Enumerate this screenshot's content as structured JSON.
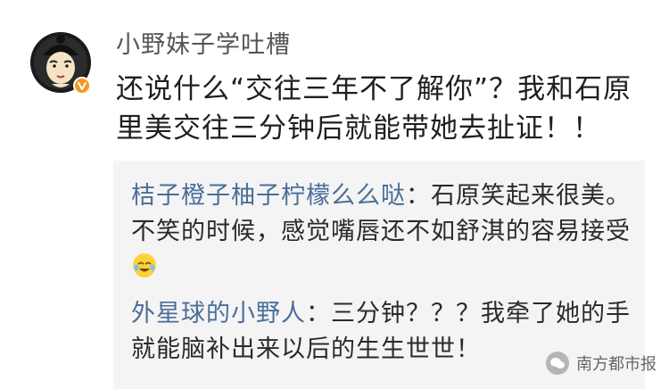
{
  "post": {
    "username": "小野妹子学吐槽",
    "text": "还说什么“交往三年不了解你”？我和石原里美交往三分钟后就能带她去扯证！！"
  },
  "comments": [
    {
      "author": "桔子橙子柚子柠檬么么哒",
      "separator": "：",
      "text": "石原笑起来很美。不笑的时候，感觉嘴唇还不如舒淇的容易接受"
    },
    {
      "author": "外星球的小野人",
      "separator": "：",
      "text": "三分钟？？？我牵了她的手就能脑补出来以后的生生世世！"
    }
  ],
  "watermark": {
    "text": "南方都市报"
  },
  "icons": {
    "avatar": "cartoon-avatar-icon",
    "verified": "verified-badge-icon",
    "emoji": "laughing-crying-emoji-icon",
    "watermark": "wechat-logo-icon"
  }
}
